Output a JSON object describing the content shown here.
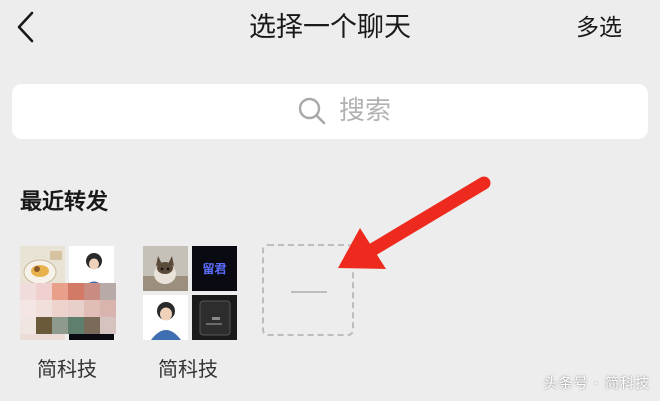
{
  "header": {
    "title": "选择一个聊天",
    "multi_select": "多选"
  },
  "search": {
    "placeholder": "搜索"
  },
  "recent": {
    "section_title": "最近转发",
    "items": [
      {
        "name": "简科技"
      },
      {
        "name": "简科技"
      }
    ]
  },
  "tile_text": {
    "neon": "留君"
  },
  "watermark": "头条号 · 简科技",
  "colors": {
    "background": "#ededed",
    "search_bg": "#ffffff",
    "arrow": "#ee2a1f",
    "dashed_border": "#bdbdbd",
    "placeholder": "#b2b2b2"
  }
}
